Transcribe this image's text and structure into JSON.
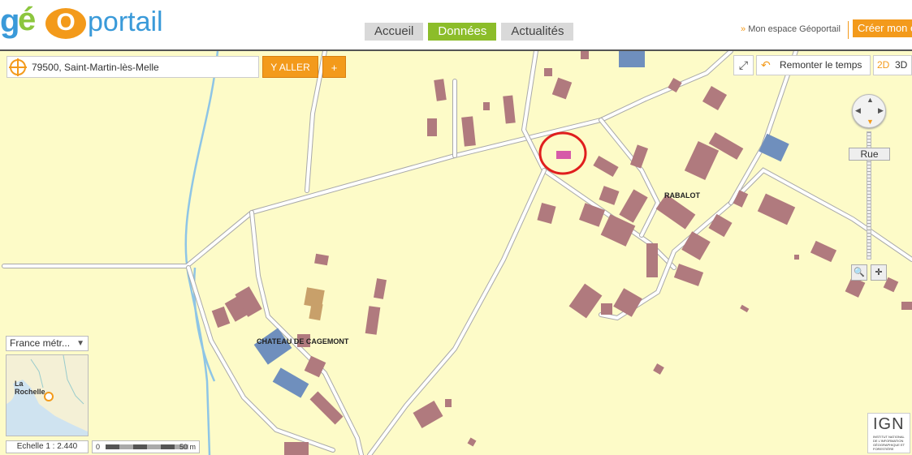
{
  "header": {
    "logo_prefix": "géo",
    "logo_rest": "portail",
    "nav_tabs": [
      {
        "label": "Accueil",
        "active": false
      },
      {
        "label": "Données",
        "active": true
      },
      {
        "label": "Actualités",
        "active": false
      }
    ],
    "my_space_label": "Mon espace Géoportail",
    "my_space_chevron": "»",
    "create_label": "Créer mon e"
  },
  "search": {
    "value": "79500, Saint-Martin-lès-Melle",
    "go_label": "Y ALLER",
    "plus_label": "+"
  },
  "map_controls": {
    "fullscreen_icon": "⤢",
    "time_label": "Remonter le temps",
    "time_icon": "↶",
    "view_2d": "2D",
    "view_3d": "3D",
    "zoom_level_label": "Rue"
  },
  "map_labels": {
    "rabalot": "RABALOT",
    "chateau": "CHATEAU DE CAGEMONT"
  },
  "minimap": {
    "projection_label": "France métr...",
    "city_label_1": "La",
    "city_label_2": "Rochelle"
  },
  "scale": {
    "echelle_label": "Echelle 1 :  2.440",
    "zero_label": "0",
    "meters_label": "50 m"
  },
  "ign": {
    "logo_text": "IGN",
    "subtitle": "INSTITUT NATIONAL DE L'INFORMATION GÉOGRAPHIQUE ET FORESTIÈRE"
  },
  "colors": {
    "accent_orange": "#f39a1b",
    "active_green": "#8cbd2a",
    "map_background": "#fdfbc8",
    "building": "#b07a7e",
    "highlight_circle": "#e01e1e"
  }
}
